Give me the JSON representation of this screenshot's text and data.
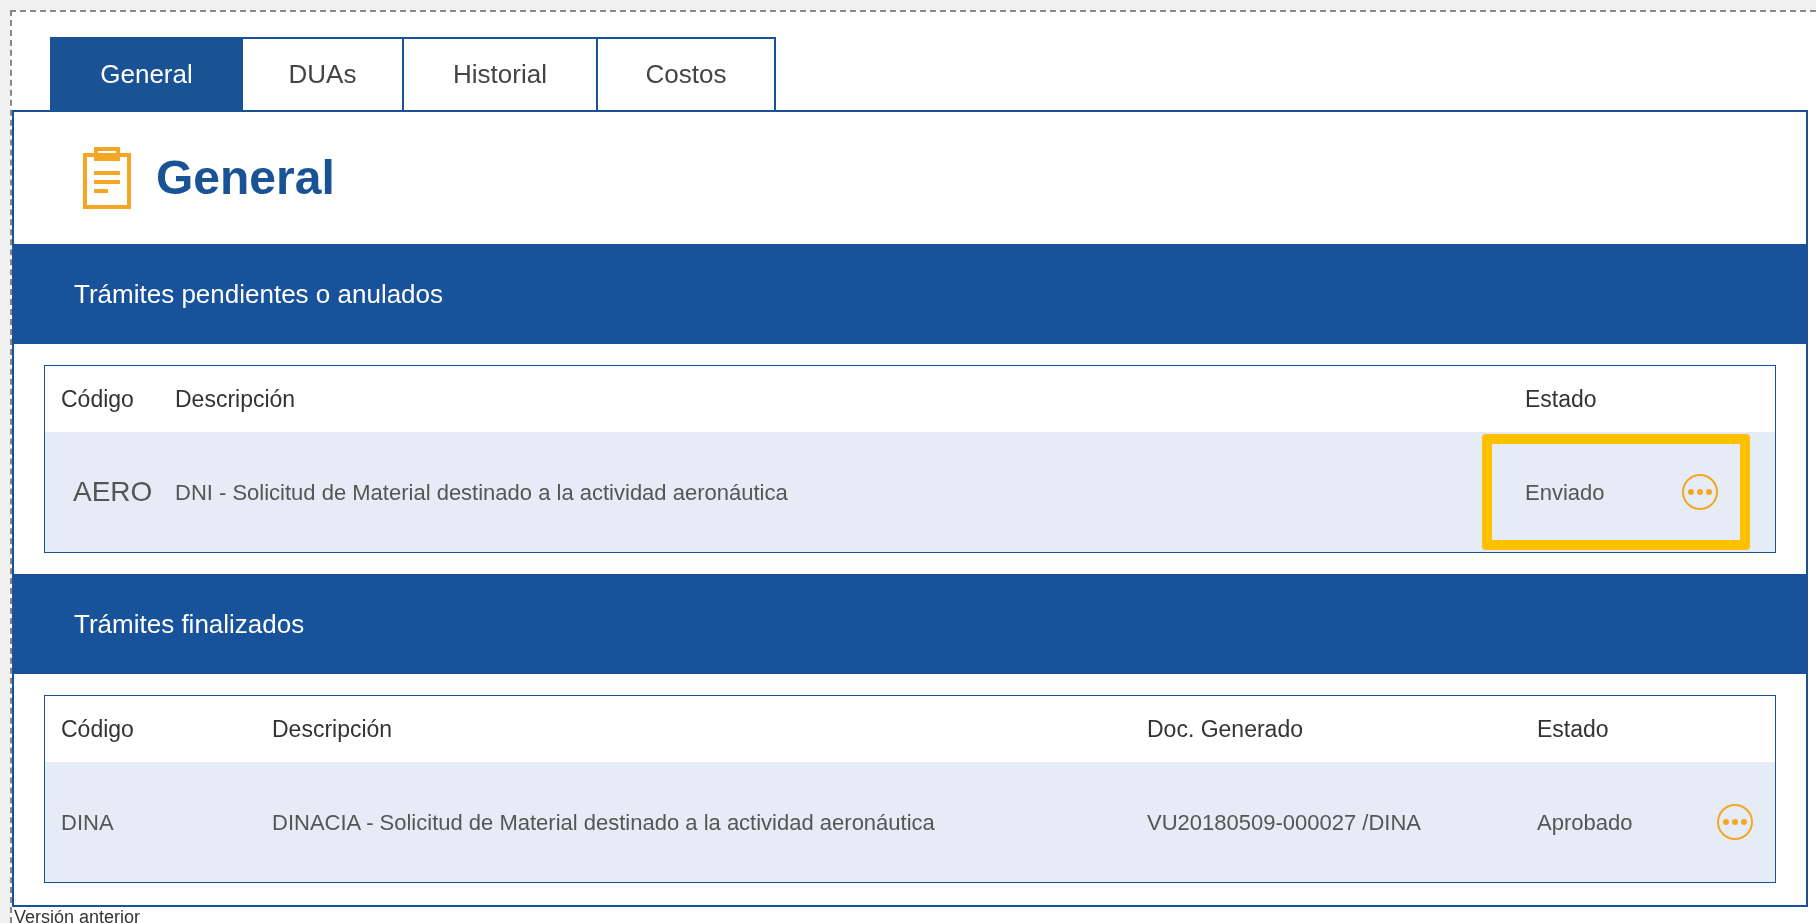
{
  "tabs": [
    {
      "label": "General",
      "selected": true
    },
    {
      "label": "DUAs",
      "selected": false
    },
    {
      "label": "Historial",
      "selected": false
    },
    {
      "label": "Costos",
      "selected": false
    }
  ],
  "heading": "General",
  "sections": [
    {
      "title": "Trámites pendientes o anulados",
      "table": {
        "columns": [
          "Código",
          "Descripción",
          "Estado"
        ],
        "rows": [
          {
            "cells": [
              "AERO",
              "DNI - Solicitud de Material destinado a la actividad aeronáutica",
              "Enviado"
            ],
            "highlighted": true
          }
        ]
      }
    },
    {
      "title": "Trámites finalizados",
      "table": {
        "columns": [
          "Código",
          "Descripción",
          "Doc. Generado",
          "Estado"
        ],
        "rows": [
          {
            "cells": [
              "DINA",
              "DINACIA - Solicitud de Material destinado a la actividad aeronáutica",
              "VU20180509-000027 /DINA",
              "Aprobado"
            ],
            "highlighted": false
          }
        ]
      }
    }
  ],
  "footer_link": "Versión anterior"
}
